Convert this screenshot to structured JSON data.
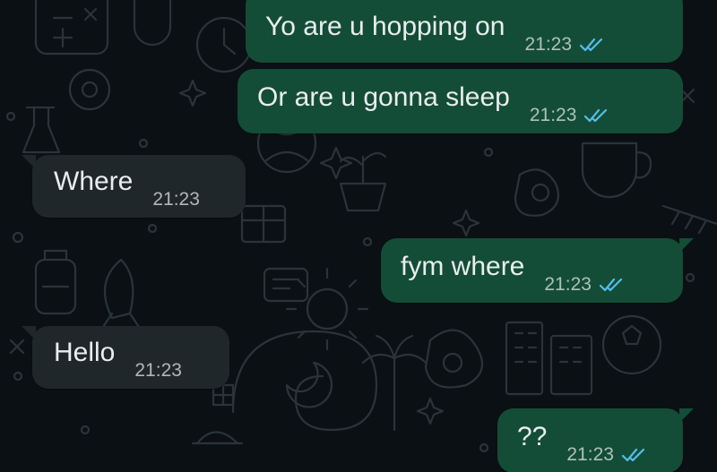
{
  "colors": {
    "background": "#0b1014",
    "outgoing_bubble": "#144d37",
    "incoming_bubble": "#1f272a",
    "text": "#e9edef",
    "read_ticks": "#53bdeb",
    "wallpaper_doodle": "#2a3438"
  },
  "icons": {
    "read_receipt": "double-check-icon"
  },
  "messages": [
    {
      "direction": "out",
      "text": "Yo are u hopping on",
      "time": "21:23",
      "status": "read"
    },
    {
      "direction": "out",
      "text": "Or are u gonna sleep",
      "time": "21:23",
      "status": "read"
    },
    {
      "direction": "in",
      "text": "Where",
      "time": "21:23"
    },
    {
      "direction": "out",
      "text": "fym where",
      "time": "21:23",
      "status": "read"
    },
    {
      "direction": "in",
      "text": "Hello",
      "time": "21:23"
    },
    {
      "direction": "out",
      "text": "??",
      "time": "21:23",
      "status": "read"
    }
  ]
}
